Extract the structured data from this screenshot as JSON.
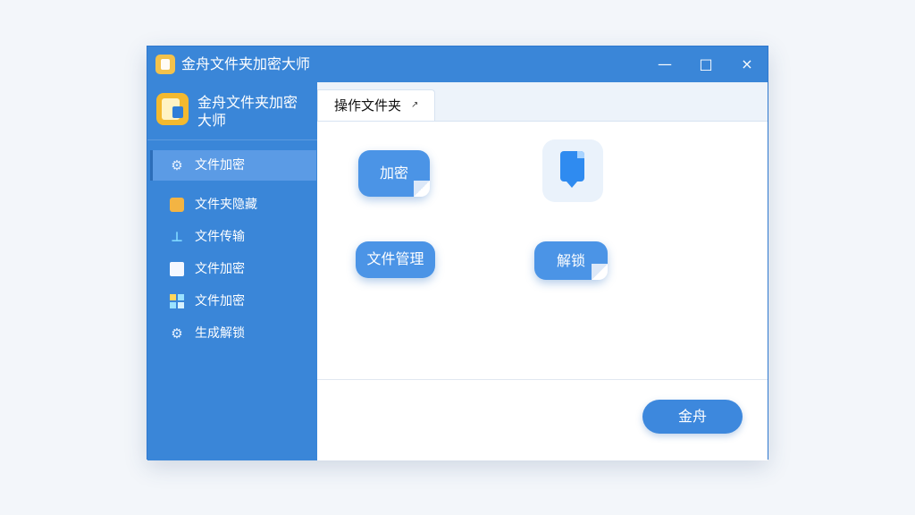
{
  "window": {
    "title": "金舟文件夹加密大师",
    "controls": {
      "minimize": "—",
      "maximize": "□",
      "close": "×"
    }
  },
  "sidebar": {
    "app_name": "金舟文件夹加密\n大师",
    "items": [
      {
        "label": "文件加密",
        "icon": "gear-icon",
        "active": true
      },
      {
        "label": "文件夹隐藏",
        "icon": "folder-icon",
        "active": false
      },
      {
        "label": "文件传输",
        "icon": "upload-icon",
        "active": false
      },
      {
        "label": "文件加密",
        "icon": "document-icon",
        "active": false
      },
      {
        "label": "文件加密",
        "icon": "grid-icon",
        "active": false
      },
      {
        "label": "生成解锁",
        "icon": "gear-icon",
        "active": false
      }
    ]
  },
  "main": {
    "tab": {
      "label": "操作文件夹",
      "mark": "↗"
    },
    "tiles": [
      {
        "label": "加密"
      },
      {
        "label": "文件管理"
      },
      {
        "label": "解锁"
      }
    ],
    "primary_button": "金舟"
  },
  "colors": {
    "primary": "#3a86d8",
    "sidebar_active": "#5b9be5",
    "tile": "#4b94e6",
    "background": "#f3f6fa"
  }
}
